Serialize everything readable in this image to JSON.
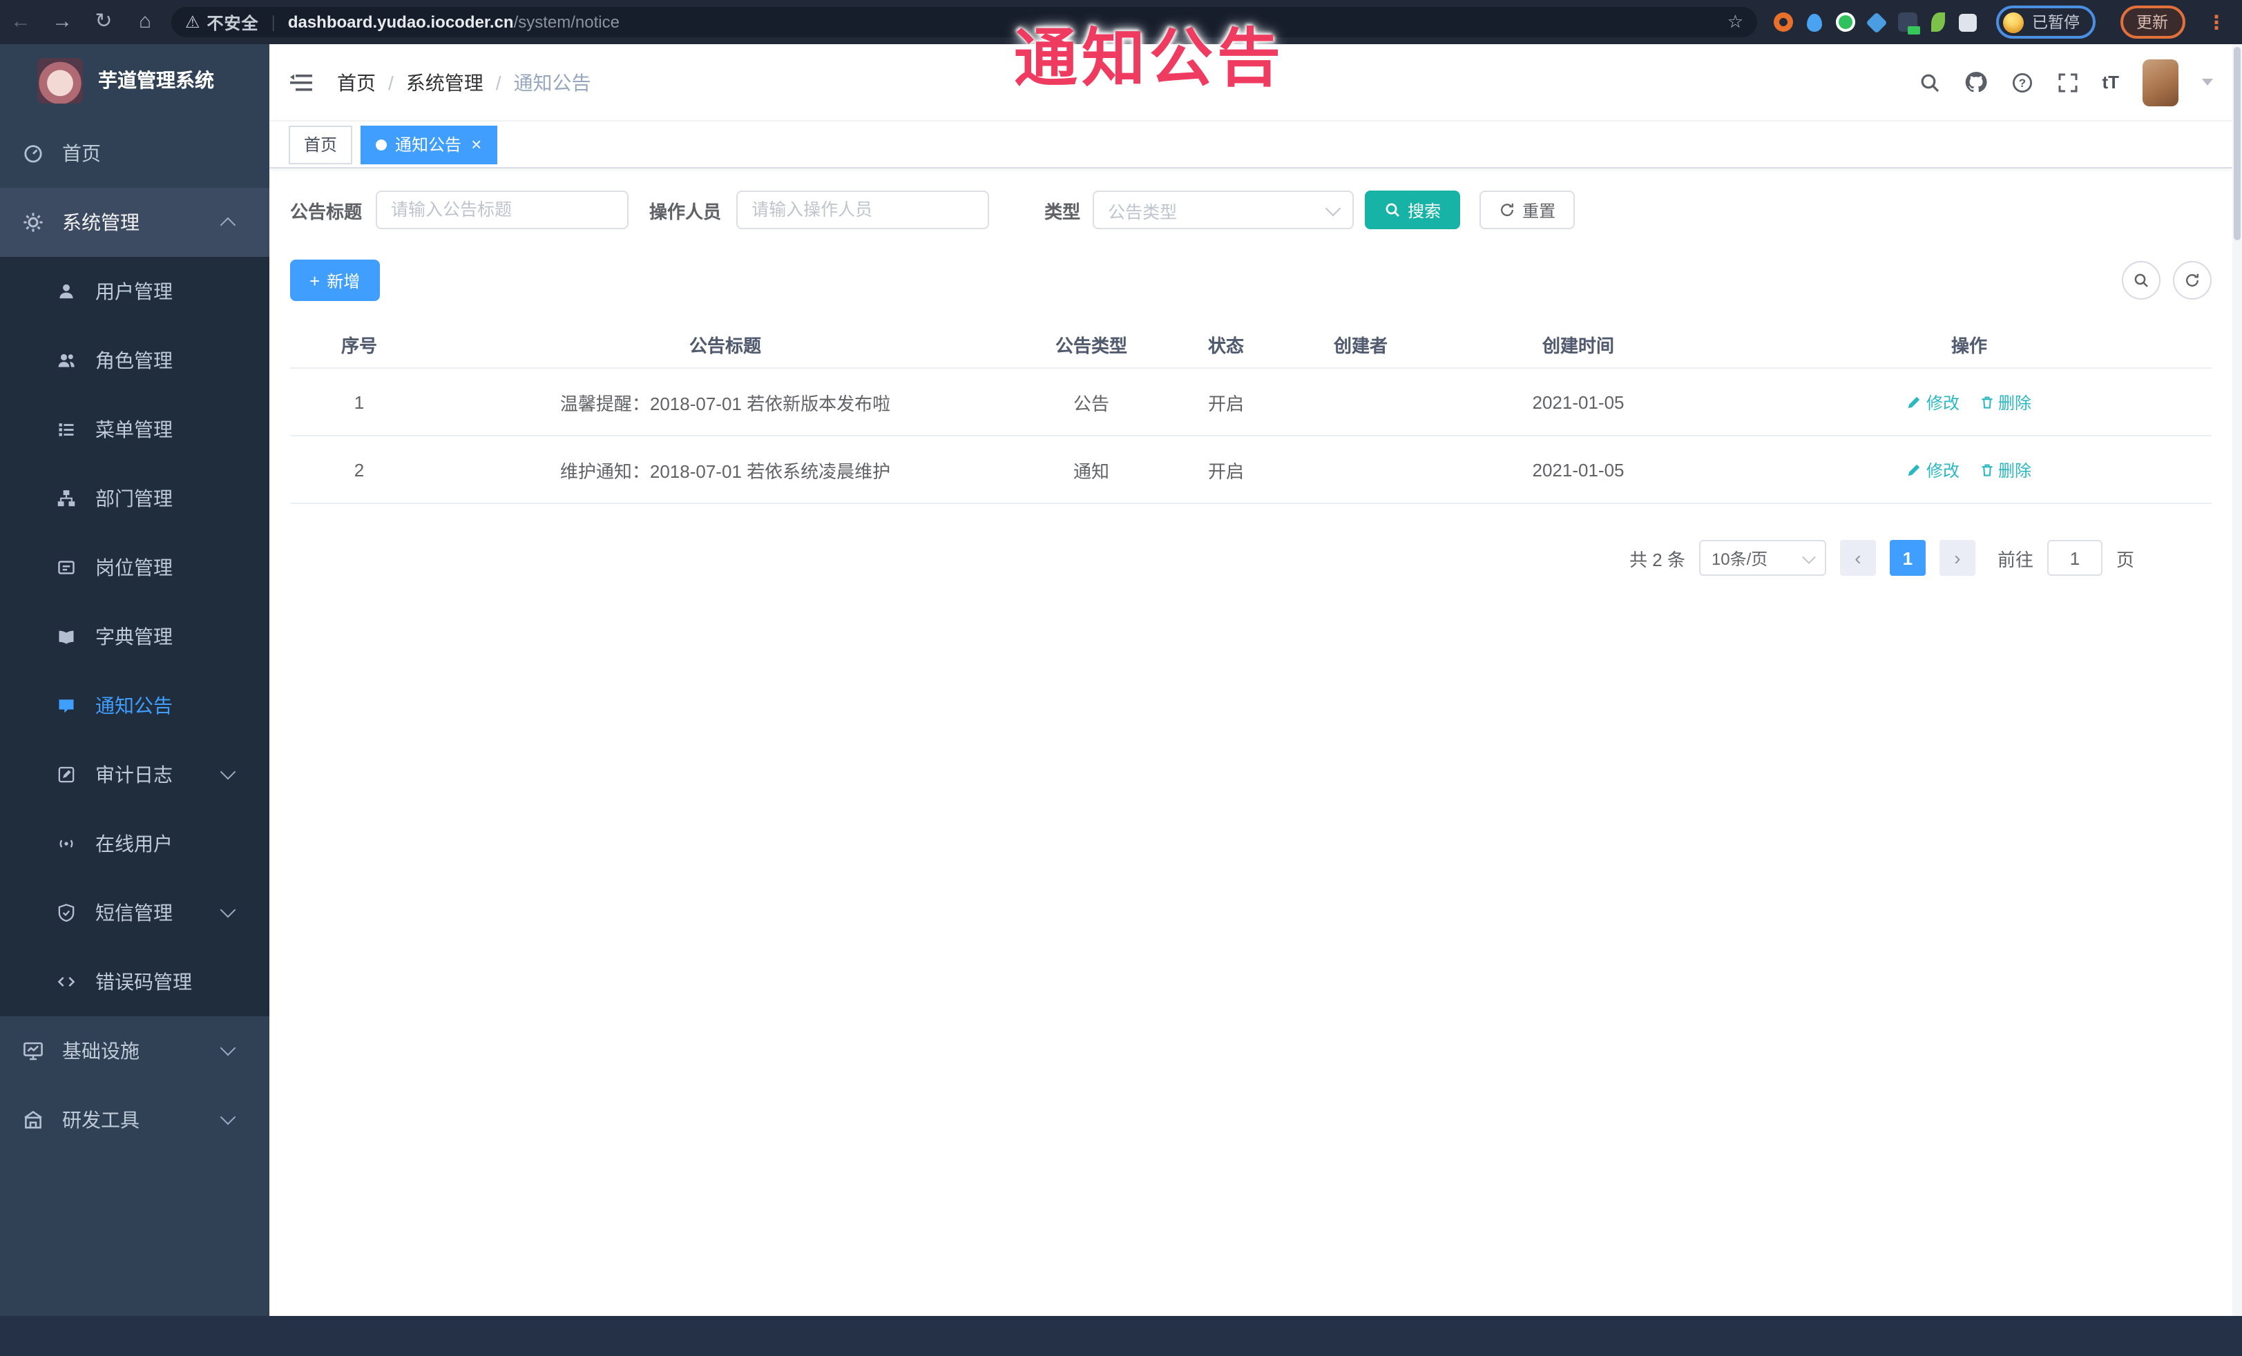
{
  "browser": {
    "security_label": "不安全",
    "url_host": "dashboard.yudao.iocoder.cn",
    "url_path": "/system/notice",
    "paused_label": "已暂停",
    "update_label": "更新"
  },
  "glyphs": {
    "back": "←",
    "forward": "→",
    "reload": "↻",
    "home": "⌂",
    "warning": "⚠",
    "pipe": "|",
    "star": "☆",
    "dots": "⋮",
    "close": "×",
    "plus": "+",
    "prev": "‹",
    "next": "›",
    "font_size": "tT"
  },
  "watermark": {
    "text": "通知公告"
  },
  "sidebar": {
    "logo_title": "芋道管理系统",
    "items": [
      {
        "label": "首页"
      },
      {
        "label": "系统管理"
      },
      {
        "label": "用户管理"
      },
      {
        "label": "角色管理"
      },
      {
        "label": "菜单管理"
      },
      {
        "label": "部门管理"
      },
      {
        "label": "岗位管理"
      },
      {
        "label": "字典管理"
      },
      {
        "label": "通知公告"
      },
      {
        "label": "审计日志"
      },
      {
        "label": "在线用户"
      },
      {
        "label": "短信管理"
      },
      {
        "label": "错误码管理"
      },
      {
        "label": "基础设施"
      },
      {
        "label": "研发工具"
      }
    ]
  },
  "header": {
    "breadcrumb": [
      "首页",
      "系统管理",
      "通知公告"
    ]
  },
  "tabs": [
    {
      "label": "首页"
    },
    {
      "label": "通知公告"
    }
  ],
  "filters": {
    "title_label": "公告标题",
    "title_placeholder": "请输入公告标题",
    "operator_label": "操作人员",
    "operator_placeholder": "请输入操作人员",
    "type_label": "类型",
    "type_placeholder": "公告类型",
    "search": "搜索",
    "reset": "重置"
  },
  "toolbar": {
    "add": "新增"
  },
  "table": {
    "columns": [
      "序号",
      "公告标题",
      "公告类型",
      "状态",
      "创建者",
      "创建时间",
      "操作"
    ],
    "edit_label": "修改",
    "delete_label": "删除",
    "rows": [
      {
        "no": "1",
        "title": "温馨提醒：2018-07-01 若依新版本发布啦",
        "type": "公告",
        "status": "开启",
        "creator": "",
        "time": "2021-01-05"
      },
      {
        "no": "2",
        "title": "维护通知：2018-07-01 若依系统凌晨维护",
        "type": "通知",
        "status": "开启",
        "creator": "",
        "time": "2021-01-05"
      }
    ]
  },
  "pagination": {
    "total": "共 2 条",
    "page_size": "10条/页",
    "current": "1",
    "goto_label": "前往",
    "goto_value": "1",
    "unit": "页"
  },
  "colors": {
    "accent": "#409EFF",
    "teal_button": "#17b3a6",
    "link_teal": "#2bb8c0",
    "annotation_pink": "#ee3b5f",
    "sidebar_bg": "#304156",
    "submenu_bg": "#1f2d3d"
  }
}
